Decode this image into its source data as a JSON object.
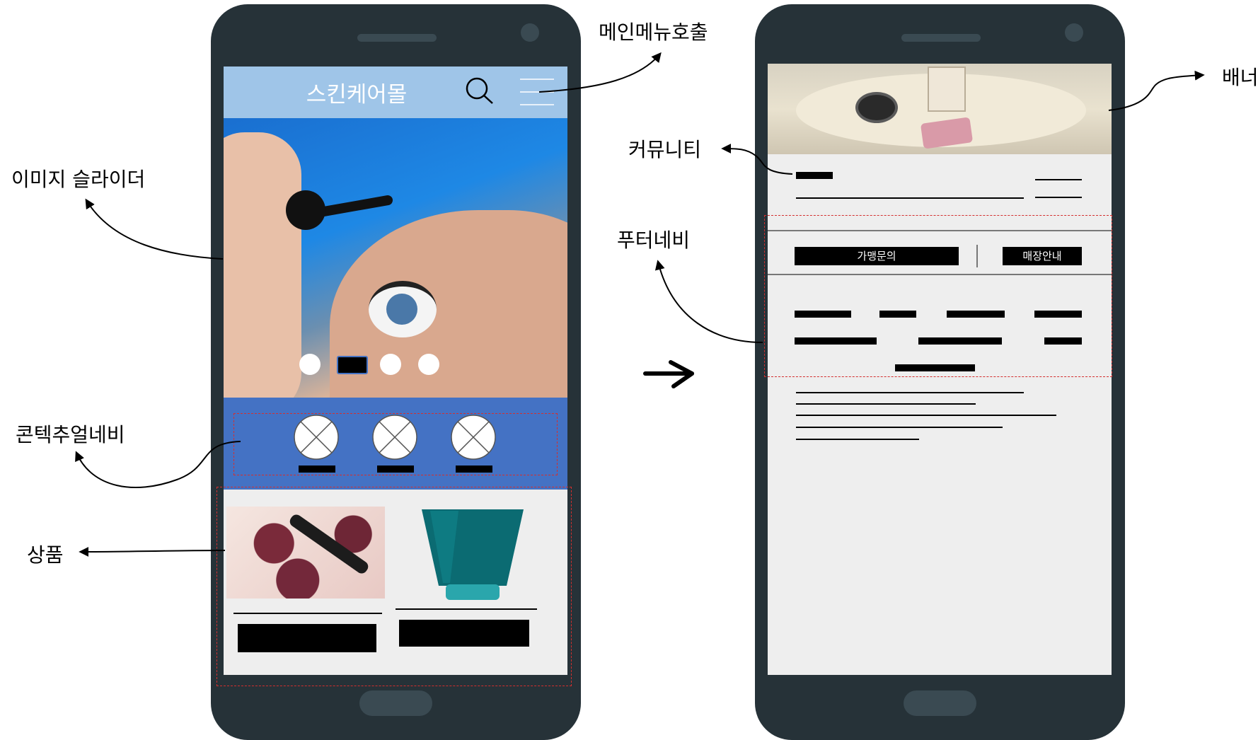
{
  "annotations": {
    "main_menu": "메인메뉴호출",
    "image_slider": "이미지 슬라이더",
    "contextual_nav": "콘텍추얼네비",
    "product": "상품",
    "banner": "배너",
    "community": "커뮤니티",
    "footer_nav": "푸터네비"
  },
  "phone1": {
    "header_title": "스킨케어몰",
    "header_color": "#9fc5e8",
    "slider_active_index": 1,
    "slider_dot_count": 4,
    "contextual_nav_color": "#4472c4",
    "contextual_items": 3,
    "products": 2
  },
  "phone2": {
    "footer_tabs": [
      "가맹문의",
      "매장안내"
    ]
  },
  "colors": {
    "phone_body": "#263238",
    "screen_bg": "#eeeeee",
    "dashed": "#d32f2f"
  },
  "icons": [
    "search-icon",
    "hamburger-menu-icon",
    "image-placeholder-icon",
    "arrow-right-icon"
  ]
}
